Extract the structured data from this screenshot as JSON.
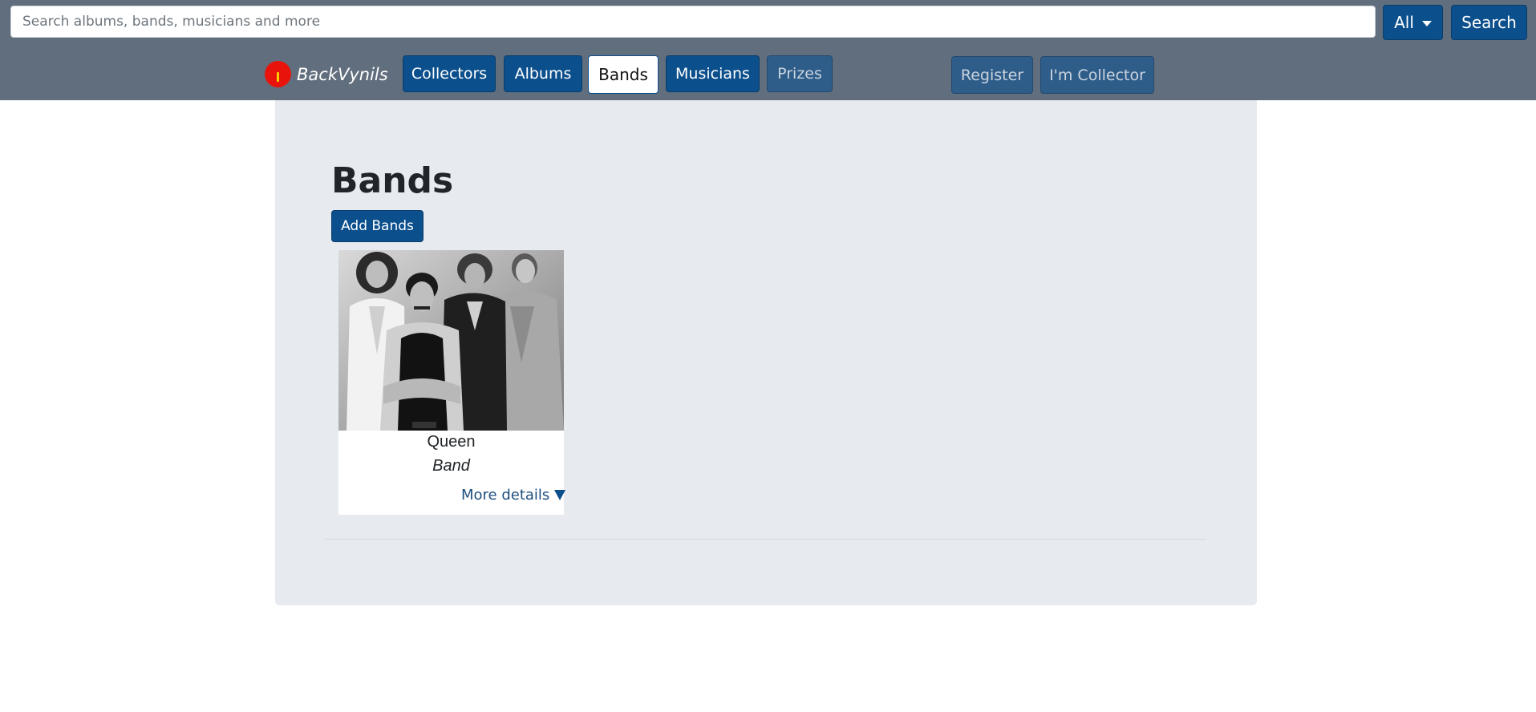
{
  "search": {
    "placeholder": "Search albums, bands, musicians and more",
    "filter_label": "All",
    "button_label": "Search"
  },
  "brand": {
    "name": "BackVynils",
    "logo_icon": "vinyl-logo-icon"
  },
  "nav": {
    "items": [
      {
        "label": "Collectors"
      },
      {
        "label": "Albums"
      },
      {
        "label": "Bands"
      },
      {
        "label": "Musicians"
      },
      {
        "label": "Prizes"
      }
    ],
    "active": "Bands",
    "register_label": "Register",
    "collector_label": "I'm Collector"
  },
  "main": {
    "title": "Bands",
    "add_button_label": "Add Bands",
    "cards": [
      {
        "name": "Queen",
        "type": "Band",
        "more_label": "More details"
      }
    ]
  },
  "colors": {
    "topbar": "#616e7d",
    "primary": "#0b4f8c",
    "panel": "#e7eaee",
    "logo": "#e8140c"
  }
}
